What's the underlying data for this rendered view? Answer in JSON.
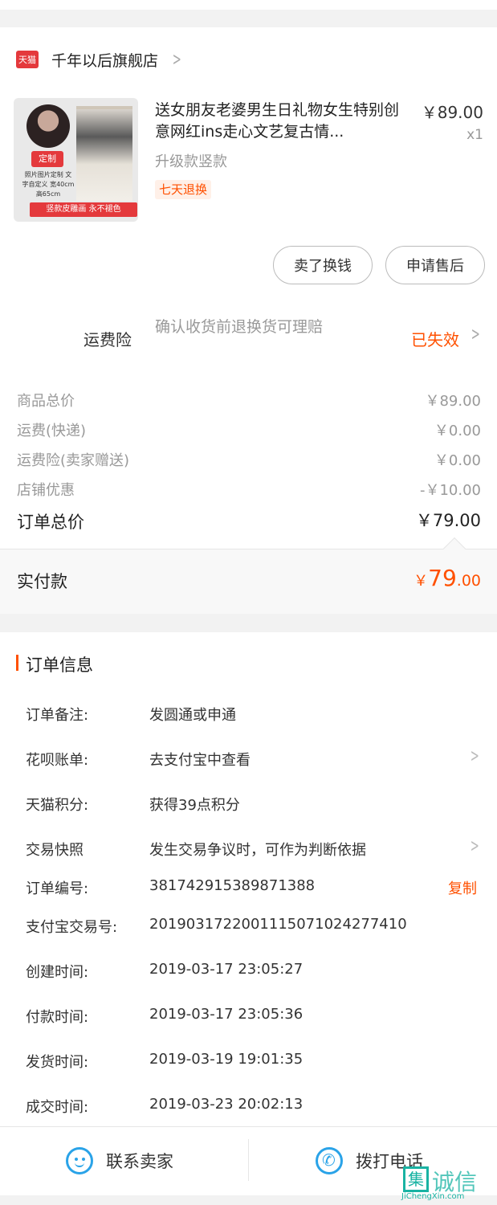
{
  "shop": {
    "badge": "天猫",
    "name": "千年以后旗舰店"
  },
  "product": {
    "title": "送女朋友老婆男生日礼物女生特别创意网红ins走心文艺复古情...",
    "price": "￥89.00",
    "qty": "x1",
    "spec": "升级款竖款",
    "return_tag": "七天退换",
    "thumb_badge": "定制",
    "thumb_text": "照片图片定制 文字自定义 宽40cm 高65cm",
    "thumb_banner": "竖款皮雕画  永不褪色"
  },
  "actions": {
    "sell": "卖了换钱",
    "after_sale": "申请售后"
  },
  "insurance": {
    "label": "运费险",
    "desc": "确认收货前退换货可理赔",
    "status": "已失效"
  },
  "price_lines": [
    {
      "label": "商品总价",
      "value": "￥89.00"
    },
    {
      "label": "运费(快递)",
      "value": "￥0.00"
    },
    {
      "label": "运费险(卖家赠送)",
      "value": "￥0.00"
    },
    {
      "label": "店铺优惠",
      "value": "-￥10.00"
    }
  ],
  "order_total": {
    "label": "订单总价",
    "value": "￥79.00"
  },
  "paid": {
    "label": "实付款",
    "symbol": "￥",
    "int": "79",
    "dec": ".00"
  },
  "order_info": {
    "title": "订单信息",
    "rows": [
      {
        "label": "订单备注:",
        "value": "发圆通或申通"
      },
      {
        "label": "花呗账单:",
        "value": "去支付宝中查看"
      },
      {
        "label": "天猫积分:",
        "value": "获得39点积分"
      },
      {
        "label": "交易快照",
        "value": "发生交易争议时，可作为判断依据"
      },
      {
        "label": "订单编号:",
        "value": "381742915389871388"
      },
      {
        "label": "支付宝交易号:",
        "value": "2019031722001115071024277410"
      },
      {
        "label": "创建时间:",
        "value": "2019-03-17 23:05:27"
      },
      {
        "label": "付款时间:",
        "value": "2019-03-17 23:05:36"
      },
      {
        "label": "发货时间:",
        "value": "2019-03-19 19:01:35"
      },
      {
        "label": "成交时间:",
        "value": "2019-03-23 20:02:13"
      }
    ],
    "copy": "复制"
  },
  "bottom": {
    "contact": "联系卖家",
    "call": "拨打电话"
  },
  "watermark": {
    "cn": "诚信",
    "url": "JiChengXin.com"
  },
  "colors": {
    "accent": "#ff5000",
    "tmall": "#e4393c",
    "icon_blue": "#2aa3e8"
  }
}
